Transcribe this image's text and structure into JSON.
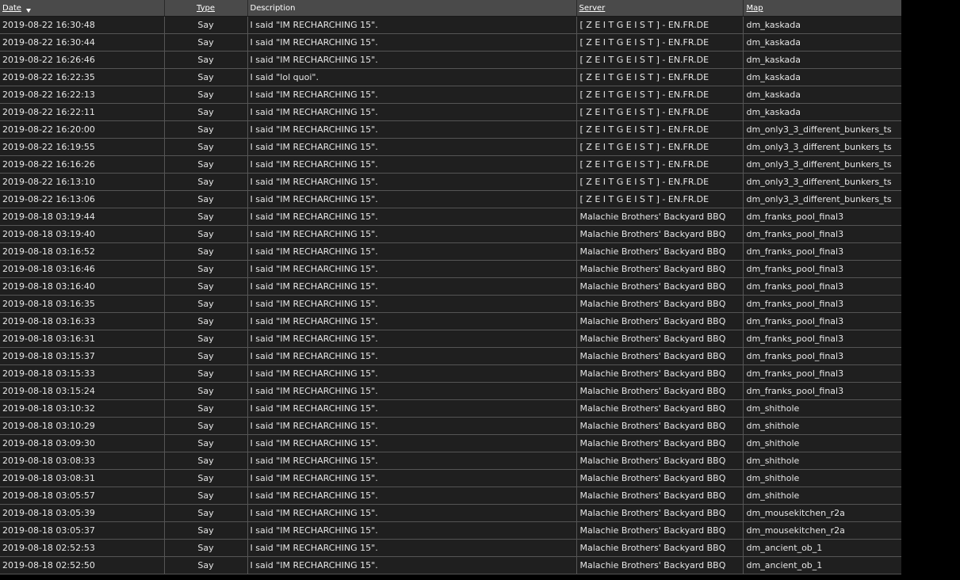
{
  "table": {
    "headers": {
      "date": "Date",
      "type": "Type",
      "description": "Description",
      "server": "Server",
      "map": "Map"
    },
    "sort": {
      "column": "date",
      "direction": "descending"
    },
    "rows": [
      {
        "date": "2019-08-22 16:30:48",
        "type": "Say",
        "description": "I said \"IM RECHARCHING 15\".",
        "server": "[ Z E I T G E I S T ] - EN.FR.DE",
        "map": "dm_kaskada"
      },
      {
        "date": "2019-08-22 16:30:44",
        "type": "Say",
        "description": "I said \"IM RECHARCHING 15\".",
        "server": "[ Z E I T G E I S T ] - EN.FR.DE",
        "map": "dm_kaskada"
      },
      {
        "date": "2019-08-22 16:26:46",
        "type": "Say",
        "description": "I said \"IM RECHARCHING 15\".",
        "server": "[ Z E I T G E I S T ] - EN.FR.DE",
        "map": "dm_kaskada"
      },
      {
        "date": "2019-08-22 16:22:35",
        "type": "Say",
        "description": "I said \"lol quoi\".",
        "server": "[ Z E I T G E I S T ] - EN.FR.DE",
        "map": "dm_kaskada"
      },
      {
        "date": "2019-08-22 16:22:13",
        "type": "Say",
        "description": "I said \"IM RECHARCHING 15\".",
        "server": "[ Z E I T G E I S T ] - EN.FR.DE",
        "map": "dm_kaskada"
      },
      {
        "date": "2019-08-22 16:22:11",
        "type": "Say",
        "description": "I said \"IM RECHARCHING 15\".",
        "server": "[ Z E I T G E I S T ] - EN.FR.DE",
        "map": "dm_kaskada"
      },
      {
        "date": "2019-08-22 16:20:00",
        "type": "Say",
        "description": "I said \"IM RECHARCHING 15\".",
        "server": "[ Z E I T G E I S T ] - EN.FR.DE",
        "map": "dm_only3_3_different_bunkers_ts"
      },
      {
        "date": "2019-08-22 16:19:55",
        "type": "Say",
        "description": "I said \"IM RECHARCHING 15\".",
        "server": "[ Z E I T G E I S T ] - EN.FR.DE",
        "map": "dm_only3_3_different_bunkers_ts"
      },
      {
        "date": "2019-08-22 16:16:26",
        "type": "Say",
        "description": "I said \"IM RECHARCHING 15\".",
        "server": "[ Z E I T G E I S T ] - EN.FR.DE",
        "map": "dm_only3_3_different_bunkers_ts"
      },
      {
        "date": "2019-08-22 16:13:10",
        "type": "Say",
        "description": "I said \"IM RECHARCHING 15\".",
        "server": "[ Z E I T G E I S T ] - EN.FR.DE",
        "map": "dm_only3_3_different_bunkers_ts"
      },
      {
        "date": "2019-08-22 16:13:06",
        "type": "Say",
        "description": "I said \"IM RECHARCHING 15\".",
        "server": "[ Z E I T G E I S T ] - EN.FR.DE",
        "map": "dm_only3_3_different_bunkers_ts"
      },
      {
        "date": "2019-08-18 03:19:44",
        "type": "Say",
        "description": "I said \"IM RECHARCHING 15\".",
        "server": "Malachie Brothers' Backyard BBQ",
        "map": "dm_franks_pool_final3"
      },
      {
        "date": "2019-08-18 03:19:40",
        "type": "Say",
        "description": "I said \"IM RECHARCHING 15\".",
        "server": "Malachie Brothers' Backyard BBQ",
        "map": "dm_franks_pool_final3"
      },
      {
        "date": "2019-08-18 03:16:52",
        "type": "Say",
        "description": "I said \"IM RECHARCHING 15\".",
        "server": "Malachie Brothers' Backyard BBQ",
        "map": "dm_franks_pool_final3"
      },
      {
        "date": "2019-08-18 03:16:46",
        "type": "Say",
        "description": "I said \"IM RECHARCHING 15\".",
        "server": "Malachie Brothers' Backyard BBQ",
        "map": "dm_franks_pool_final3"
      },
      {
        "date": "2019-08-18 03:16:40",
        "type": "Say",
        "description": "I said \"IM RECHARCHING 15\".",
        "server": "Malachie Brothers' Backyard BBQ",
        "map": "dm_franks_pool_final3"
      },
      {
        "date": "2019-08-18 03:16:35",
        "type": "Say",
        "description": "I said \"IM RECHARCHING 15\".",
        "server": "Malachie Brothers' Backyard BBQ",
        "map": "dm_franks_pool_final3"
      },
      {
        "date": "2019-08-18 03:16:33",
        "type": "Say",
        "description": "I said \"IM RECHARCHING 15\".",
        "server": "Malachie Brothers' Backyard BBQ",
        "map": "dm_franks_pool_final3"
      },
      {
        "date": "2019-08-18 03:16:31",
        "type": "Say",
        "description": "I said \"IM RECHARCHING 15\".",
        "server": "Malachie Brothers' Backyard BBQ",
        "map": "dm_franks_pool_final3"
      },
      {
        "date": "2019-08-18 03:15:37",
        "type": "Say",
        "description": "I said \"IM RECHARCHING 15\".",
        "server": "Malachie Brothers' Backyard BBQ",
        "map": "dm_franks_pool_final3"
      },
      {
        "date": "2019-08-18 03:15:33",
        "type": "Say",
        "description": "I said \"IM RECHARCHING 15\".",
        "server": "Malachie Brothers' Backyard BBQ",
        "map": "dm_franks_pool_final3"
      },
      {
        "date": "2019-08-18 03:15:24",
        "type": "Say",
        "description": "I said \"IM RECHARCHING 15\".",
        "server": "Malachie Brothers' Backyard BBQ",
        "map": "dm_franks_pool_final3"
      },
      {
        "date": "2019-08-18 03:10:32",
        "type": "Say",
        "description": "I said \"IM RECHARCHING 15\".",
        "server": "Malachie Brothers' Backyard BBQ",
        "map": "dm_shithole"
      },
      {
        "date": "2019-08-18 03:10:29",
        "type": "Say",
        "description": "I said \"IM RECHARCHING 15\".",
        "server": "Malachie Brothers' Backyard BBQ",
        "map": "dm_shithole"
      },
      {
        "date": "2019-08-18 03:09:30",
        "type": "Say",
        "description": "I said \"IM RECHARCHING 15\".",
        "server": "Malachie Brothers' Backyard BBQ",
        "map": "dm_shithole"
      },
      {
        "date": "2019-08-18 03:08:33",
        "type": "Say",
        "description": "I said \"IM RECHARCHING 15\".",
        "server": "Malachie Brothers' Backyard BBQ",
        "map": "dm_shithole"
      },
      {
        "date": "2019-08-18 03:08:31",
        "type": "Say",
        "description": "I said \"IM RECHARCHING 15\".",
        "server": "Malachie Brothers' Backyard BBQ",
        "map": "dm_shithole"
      },
      {
        "date": "2019-08-18 03:05:57",
        "type": "Say",
        "description": "I said \"IM RECHARCHING 15\".",
        "server": "Malachie Brothers' Backyard BBQ",
        "map": "dm_shithole"
      },
      {
        "date": "2019-08-18 03:05:39",
        "type": "Say",
        "description": "I said \"IM RECHARCHING 15\".",
        "server": "Malachie Brothers' Backyard BBQ",
        "map": "dm_mousekitchen_r2a"
      },
      {
        "date": "2019-08-18 03:05:37",
        "type": "Say",
        "description": "I said \"IM RECHARCHING 15\".",
        "server": "Malachie Brothers' Backyard BBQ",
        "map": "dm_mousekitchen_r2a"
      },
      {
        "date": "2019-08-18 02:52:53",
        "type": "Say",
        "description": "I said \"IM RECHARCHING 15\".",
        "server": "Malachie Brothers' Backyard BBQ",
        "map": "dm_ancient_ob_1"
      },
      {
        "date": "2019-08-18 02:52:50",
        "type": "Say",
        "description": "I said \"IM RECHARCHING 15\".",
        "server": "Malachie Brothers' Backyard BBQ",
        "map": "dm_ancient_ob_1"
      }
    ]
  }
}
